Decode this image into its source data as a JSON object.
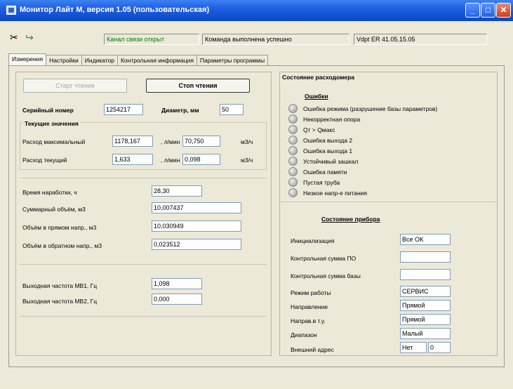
{
  "window": {
    "title": "Монитор Лайт М, версия 1.05 (пользовательская)"
  },
  "toolbar": {
    "channel_status": "Канал связи открыт",
    "command_status": "Команда выполнена успешно",
    "device_version": "Vdpt ER 41.05.15.05"
  },
  "tabs": [
    "Измерения",
    "Настройки",
    "Индикатор",
    "Контрольная информация",
    "Параметры программы"
  ],
  "measure": {
    "start_button": "Старт чтения",
    "stop_button": "Стоп чтения",
    "serial_label": "Серийный номер",
    "serial_value": "1254217",
    "diameter_label": "Диаметр, мм",
    "diameter_value": "50",
    "current_group_title": "Текущие значения",
    "flow_max_label": "Расход максимальный",
    "flow_max_value": "1178,167",
    "flow_max_unit_left": ", л/мин",
    "flow_max_value2": "70,750",
    "flow_max_unit_right": "м3/ч",
    "flow_cur_label": "Расход текущий",
    "flow_cur_value": "1,633",
    "flow_cur_unit_left": ", л/мин",
    "flow_cur_value2": "0,098",
    "flow_cur_unit_right": "м3/ч",
    "runtime_label": "Время наработки, ч",
    "runtime_value": "28,30",
    "total_volume_label": "Суммарный объём, м3",
    "total_volume_value": "10,007437",
    "forward_volume_label": "Объём в прямом напр., м3",
    "forward_volume_value": "10,030949",
    "reverse_volume_label": "Объём в обратном напр., м3",
    "reverse_volume_value": "0,023512",
    "freq1_label": "Выходная частота МВ1, Гц",
    "freq1_value": "1,098",
    "freq2_label": "Выходная частота МВ2, Гц",
    "freq2_value": "0,000"
  },
  "state": {
    "title": "Состояние расходомера",
    "errors_title": "Ошибки",
    "errors": [
      "Ошибка режима (разрушение базы параметров)",
      "Некорректная опора",
      "Qт > Qмакс",
      "Ошибка выхода 2",
      "Ошибка выхода 1",
      "Устойчивый зашкал",
      "Ошибка памяти",
      "Пустая труба",
      "Низкое напр-е питания"
    ],
    "device_title": "Состояние прибора",
    "device_rows": [
      {
        "label": "Инициализация",
        "value": "Все ОК"
      },
      {
        "label": "Контрольная сумма ПО",
        "value": ""
      },
      {
        "label": "Контрольная сумма базы",
        "value": ""
      },
      {
        "label": "Режим работы",
        "value": "СЕРВИС"
      },
      {
        "label": "Направление",
        "value": "Прямой"
      },
      {
        "label": "Направ.в т.у.",
        "value": "Прямой"
      },
      {
        "label": "Диапазон",
        "value": "Малый"
      }
    ],
    "address_label": "Внешний адрес",
    "address_value1": "Нет",
    "address_value2": "0"
  },
  "colors": {
    "titlebar": "#0a47c7",
    "channel_ok": "#008000",
    "window_bg": "#ece9d8"
  },
  "icons": {
    "toolbar_tool": "connect-plug-icon",
    "toolbar_arrow": "green-arrow-icon"
  }
}
